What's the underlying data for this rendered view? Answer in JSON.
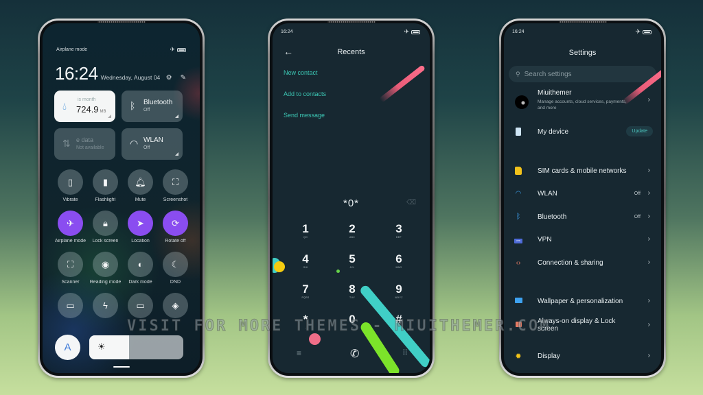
{
  "phones": {
    "control_center": {
      "status": {
        "left_text": "Airplane mode",
        "icons": [
          "airplane-icon",
          "battery-icon"
        ]
      },
      "clock": {
        "time": "16:24",
        "date": "Wednesday, August 04"
      },
      "header_icons": [
        "settings-icon",
        "edit-icon"
      ],
      "tiles": [
        {
          "id": "data-usage",
          "icon": "water-drop-icon",
          "subtitle": "is month",
          "value": "724.9",
          "unit": "MB"
        },
        {
          "id": "bluetooth",
          "icon": "bluetooth-icon",
          "title": "Bluetooth",
          "subtitle": "Off"
        },
        {
          "id": "mobile-data",
          "icon": "mobile-data-icon",
          "title": "e data",
          "subtitle": "Not available"
        },
        {
          "id": "wlan",
          "icon": "wifi-icon",
          "title": "WLAN",
          "subtitle": "Off"
        }
      ],
      "toggles": [
        {
          "label": "Vibrate",
          "icon": "vibrate-icon",
          "glyph": "▯",
          "on": false
        },
        {
          "label": "Flashlight",
          "icon": "flashlight-icon",
          "glyph": "▮",
          "on": false
        },
        {
          "label": "Mute",
          "icon": "bell-icon",
          "glyph": "🔔︎",
          "on": false
        },
        {
          "label": "Screenshot",
          "icon": "screenshot-icon",
          "glyph": "⛶",
          "on": false
        },
        {
          "label": "Airplane mode",
          "icon": "airplane-icon",
          "glyph": "✈",
          "on": true
        },
        {
          "label": "Lock screen",
          "icon": "lock-icon",
          "glyph": "🔒︎",
          "on": false
        },
        {
          "label": "Location",
          "icon": "location-icon",
          "glyph": "➤",
          "on": true
        },
        {
          "label": "Rotate off",
          "icon": "rotate-lock-icon",
          "glyph": "⟳",
          "on": true
        },
        {
          "label": "Scanner",
          "icon": "scanner-icon",
          "glyph": "⛶",
          "on": false
        },
        {
          "label": "Reading mode",
          "icon": "eye-icon",
          "glyph": "◉",
          "on": false
        },
        {
          "label": "Dark mode",
          "icon": "dark-mode-icon",
          "glyph": "◐",
          "on": false
        },
        {
          "label": "DND",
          "icon": "moon-icon",
          "glyph": "☾",
          "on": false
        },
        {
          "label": "",
          "icon": "battery-saver-icon",
          "glyph": "▭",
          "on": false
        },
        {
          "label": "",
          "icon": "lightning-icon",
          "glyph": "ϟ",
          "on": false
        },
        {
          "label": "",
          "icon": "cast-screen-icon",
          "glyph": "▭",
          "on": false
        },
        {
          "label": "",
          "icon": "kde-connect-icon",
          "glyph": "◈",
          "on": false
        }
      ],
      "auto_brightness_label": "A",
      "brightness_percent": 42
    },
    "dialer": {
      "status": {
        "time": "16:24",
        "icons": [
          "airplane-icon",
          "battery-icon"
        ]
      },
      "title": "Recents",
      "actions": [
        "New contact",
        "Add to contacts",
        "Send message"
      ],
      "number": "*0*",
      "keys": [
        {
          "num": "1",
          "letters": "QO"
        },
        {
          "num": "2",
          "letters": "ABC"
        },
        {
          "num": "3",
          "letters": "DEF"
        },
        {
          "num": "4",
          "letters": "GHI"
        },
        {
          "num": "5",
          "letters": "JKL"
        },
        {
          "num": "6",
          "letters": "MNO"
        },
        {
          "num": "7",
          "letters": "PQRS"
        },
        {
          "num": "8",
          "letters": "TUV"
        },
        {
          "num": "9",
          "letters": "WXYZ"
        },
        {
          "num": "*",
          "letters": ","
        },
        {
          "num": "0",
          "letters": "+"
        },
        {
          "num": "#",
          "letters": ""
        }
      ],
      "bottom_icons": [
        "menu-icon",
        "phone-call-icon",
        "dialpad-icon"
      ]
    },
    "settings": {
      "status": {
        "time": "16:24",
        "icons": [
          "airplane-icon",
          "battery-icon"
        ]
      },
      "title": "Settings",
      "search_placeholder": "Search settings",
      "account": {
        "name": "Miuithemer",
        "subtitle": "Manage accounts, cloud services, payments, and more"
      },
      "my_device": {
        "label": "My device",
        "badge": "Update"
      },
      "items": [
        {
          "label": "SIM cards & mobile networks",
          "icon": "sim-card-icon",
          "value": ""
        },
        {
          "label": "WLAN",
          "icon": "wifi-icon",
          "value": "Off"
        },
        {
          "label": "Bluetooth",
          "icon": "bluetooth-icon",
          "value": "Off"
        },
        {
          "label": "VPN",
          "icon": "vpn-icon",
          "value": ""
        },
        {
          "label": "Connection & sharing",
          "icon": "connection-sharing-icon",
          "value": ""
        },
        {
          "label": "Wallpaper & personalization",
          "icon": "wallpaper-icon",
          "value": ""
        },
        {
          "label": "Always-on display & Lock screen",
          "icon": "lock-screen-icon",
          "value": ""
        },
        {
          "label": "Display",
          "icon": "sun-icon",
          "value": ""
        }
      ]
    }
  },
  "glyphs": {
    "airplane": "✈",
    "back": "←",
    "chevron": "›",
    "search": "⚲",
    "bluetooth": "ᛒ",
    "wifi": "◠",
    "water": "💧︎",
    "mobile_data": "⇅",
    "settings_gear": "⚙",
    "edit": "✎",
    "sun": "☀",
    "backspace": "⌫",
    "menu": "≡",
    "phone": "✆",
    "dialpad": "⠿",
    "connection": "‹›",
    "display_sun": "✹"
  },
  "watermark": "VISIT FOR MORE THEMES - MIUITHEMER.COM",
  "colors": {
    "accent_purple": "#8a4df0",
    "accent_teal": "#3cc7b4",
    "stripe_pink": "#ff6f8c",
    "stripe_teal": "#40cfc6",
    "stripe_green": "#7ce32a",
    "dot_yellow": "#f5cc10",
    "dot_pink": "#f06e88"
  }
}
